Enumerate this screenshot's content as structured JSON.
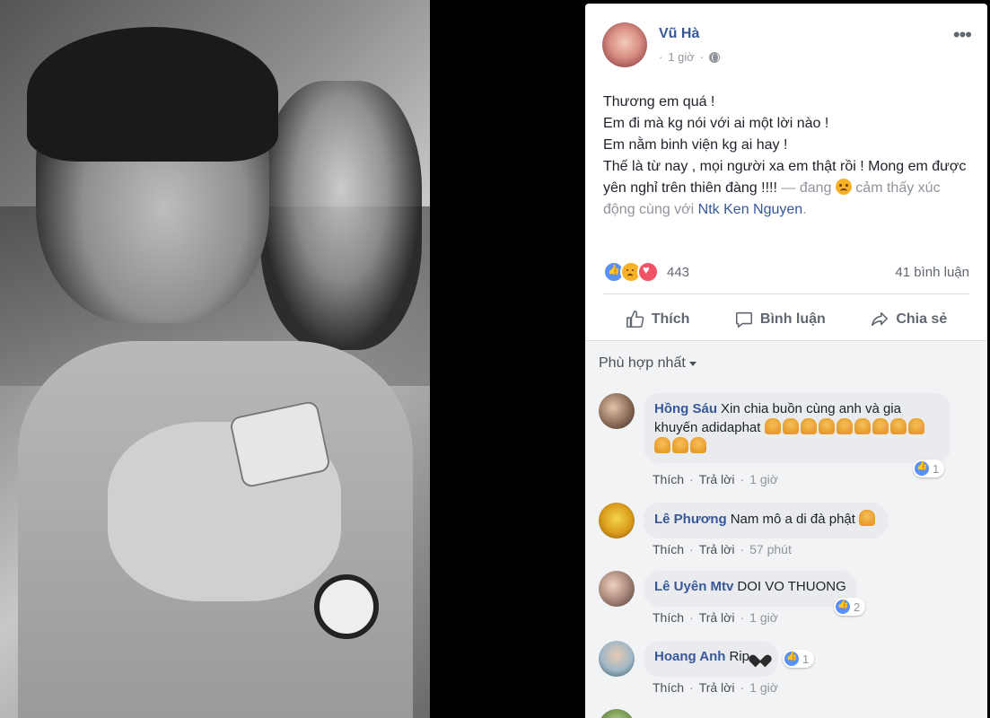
{
  "post": {
    "author": "Vũ Hà",
    "time": "1 giờ",
    "lines": [
      "Thương em quá !",
      "Em đi mà kg nói với ai một lời nào !",
      "Em nằm binh viện kg ai hay !",
      "Thế là từ nay , mọi người xa em thật rồi ! Mong em được yên nghỉ trên thiên đàng !!!!"
    ],
    "feeling_prefix": " — đang ",
    "feeling_text": " cảm thấy xúc động cùng với ",
    "tagged": "Ntk Ken Nguyen",
    "feeling_suffix": ".",
    "reaction_count": "443",
    "comment_count": "41 bình luận",
    "actions": {
      "like": "Thích",
      "comment": "Bình luận",
      "share": "Chia sẻ"
    }
  },
  "comments_section": {
    "sort_label": "Phù hợp nhất",
    "comments": [
      {
        "name": "Hồng Sáu",
        "text": "Xin chia buồn cùng anh và gia khuyến adidaphat",
        "like": "Thích",
        "reply": "Trả lời",
        "time": "1 giờ",
        "likes": "1"
      },
      {
        "name": "Lê Phương",
        "text": "Nam mô a di đà phật",
        "like": "Thích",
        "reply": "Trả lời",
        "time": "57 phút"
      },
      {
        "name": "Lê Uyên Mtv",
        "text": "DOI VO THUONG",
        "like": "Thích",
        "reply": "Trả lời",
        "time": "1 giờ",
        "likes": "2"
      },
      {
        "name": "Hoang Anh",
        "text": "Rip",
        "like": "Thích",
        "reply": "Trả lời",
        "time": "1 giờ",
        "likes": "1"
      }
    ],
    "separator": "·"
  },
  "colors": {
    "link": "#365899",
    "muted": "#90949c",
    "like_blue": "#5890ff",
    "love_red": "#f25268",
    "sad_yellow": "#f7b125"
  }
}
